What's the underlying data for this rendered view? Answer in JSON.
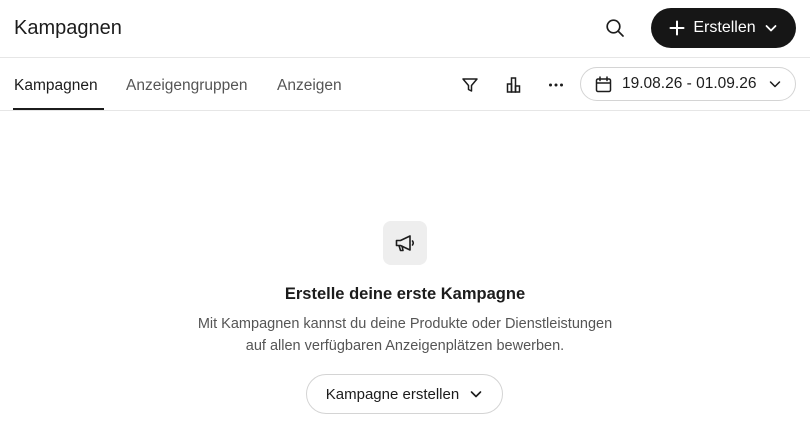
{
  "header": {
    "title": "Kampagnen",
    "search_icon": "search-icon",
    "create_button": {
      "label": "Erstellen",
      "icon": "plus-icon",
      "chevron": "chevron-down-icon"
    }
  },
  "tabs": [
    {
      "label": "Kampagnen",
      "active": true
    },
    {
      "label": "Anzeigengruppen",
      "active": false
    },
    {
      "label": "Anzeigen",
      "active": false
    }
  ],
  "toolbar": {
    "icons": [
      "filter-icon",
      "bar-chart-icon",
      "more-icon"
    ],
    "date_range": {
      "label": "19.08.26 - 01.09.26",
      "icon": "calendar-icon"
    }
  },
  "empty_state": {
    "icon": "megaphone-icon",
    "title": "Erstelle deine erste Kampagne",
    "description_line1": "Mit Kampagnen kannst du deine Produkte oder Dienstleistungen",
    "description_line2": "auf allen verfügbaren Anzeigenplätzen bewerben.",
    "button_label": "Kampagne erstellen"
  },
  "colors": {
    "primary_button_bg": "#161616",
    "text": "#1c1c1c",
    "muted_text": "#555555",
    "border": "#d4d4d4",
    "icon_tile_bg": "#eeeeee"
  }
}
